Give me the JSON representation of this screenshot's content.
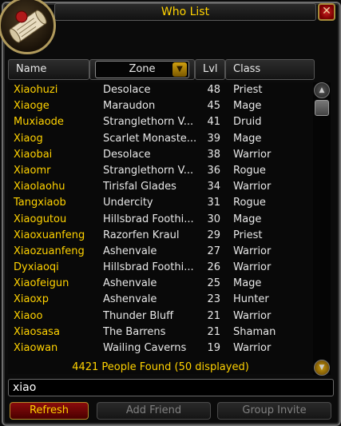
{
  "window": {
    "title": "Who List"
  },
  "columns": {
    "name": "Name",
    "zone": "Zone",
    "level": "Lvl",
    "class": "Class"
  },
  "players": [
    {
      "name": "Xiaohuzi",
      "zone": "Desolace",
      "level": "48",
      "class": "Priest"
    },
    {
      "name": "Xiaoge",
      "zone": "Maraudon",
      "level": "45",
      "class": "Mage"
    },
    {
      "name": "Muxiaode",
      "zone": "Stranglethorn V...",
      "level": "41",
      "class": "Druid"
    },
    {
      "name": "Xiaog",
      "zone": "Scarlet Monaste...",
      "level": "39",
      "class": "Mage"
    },
    {
      "name": "Xiaobai",
      "zone": "Desolace",
      "level": "38",
      "class": "Warrior"
    },
    {
      "name": "Xiaomr",
      "zone": "Stranglethorn V...",
      "level": "36",
      "class": "Rogue"
    },
    {
      "name": "Xiaolaohu",
      "zone": "Tirisfal Glades",
      "level": "34",
      "class": "Warrior"
    },
    {
      "name": "Tangxiaob",
      "zone": "Undercity",
      "level": "31",
      "class": "Rogue"
    },
    {
      "name": "Xiaogutou",
      "zone": "Hillsbrad Foothi...",
      "level": "30",
      "class": "Mage"
    },
    {
      "name": "Xiaoxuanfeng",
      "zone": "Razorfen Kraul",
      "level": "29",
      "class": "Priest"
    },
    {
      "name": "Xiaozuanfeng",
      "zone": "Ashenvale",
      "level": "27",
      "class": "Warrior"
    },
    {
      "name": "Dyxiaoqi",
      "zone": "Hillsbrad Foothi...",
      "level": "26",
      "class": "Warrior"
    },
    {
      "name": "Xiaofeigun",
      "zone": "Ashenvale",
      "level": "25",
      "class": "Mage"
    },
    {
      "name": "Xiaoxp",
      "zone": "Ashenvale",
      "level": "23",
      "class": "Hunter"
    },
    {
      "name": "Xiaoo",
      "zone": "Thunder Bluff",
      "level": "21",
      "class": "Warrior"
    },
    {
      "name": "Xiaosasa",
      "zone": "The Barrens",
      "level": "21",
      "class": "Shaman"
    },
    {
      "name": "Xiaowan",
      "zone": "Wailing Caverns",
      "level": "19",
      "class": "Warrior"
    }
  ],
  "status": {
    "found_text": "4421 People Found  (50 displayed)"
  },
  "search": {
    "value": "xiao"
  },
  "buttons": {
    "refresh": "Refresh",
    "add_friend": "Add Friend",
    "group_invite": "Group Invite"
  },
  "colors": {
    "name": "#ffd200",
    "title": "#ffd200",
    "text": "#e8e8e8",
    "disabled": "#808080"
  },
  "icons": {
    "portrait": "scroll-icon",
    "close": "close-icon",
    "dropdown": "chevron-down-icon"
  }
}
